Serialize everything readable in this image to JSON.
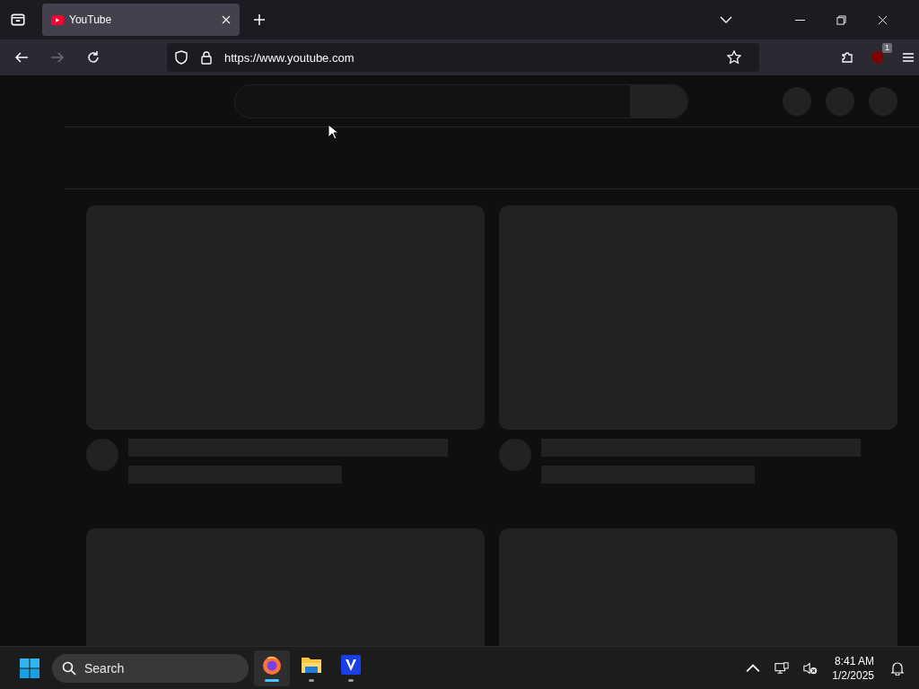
{
  "tabs": [
    {
      "title": "YouTube",
      "selected": true
    }
  ],
  "toolbar": {
    "url": "https://www.youtube.com",
    "extension_badge": "1"
  },
  "page": {
    "cards": [
      {
        "kind": "placeholder"
      },
      {
        "kind": "placeholder"
      },
      {
        "kind": "thumbnail_only"
      },
      {
        "kind": "thumbnail_only"
      }
    ]
  },
  "taskbar": {
    "search": {
      "placeholder": "Search"
    },
    "apps": [
      {
        "kind": "firefox",
        "selected": true
      },
      {
        "kind": "files",
        "selected": false
      },
      {
        "kind": "v",
        "selected": false
      }
    ],
    "clock": {
      "time": "8:41 AM",
      "date": "1/2/2025"
    }
  }
}
